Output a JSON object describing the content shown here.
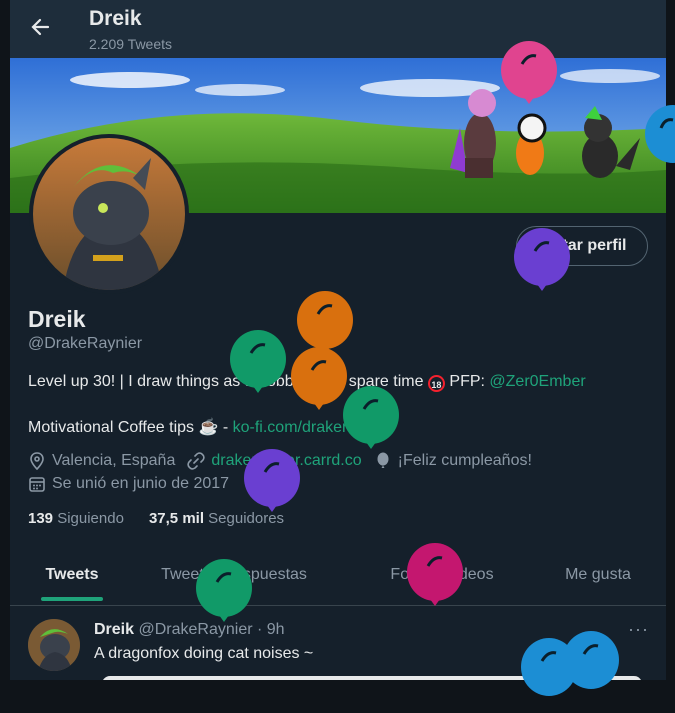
{
  "header": {
    "name": "Dreik",
    "tweet_count": "2.209 Tweets"
  },
  "profile": {
    "edit_button": "Editar perfil",
    "name": "Dreik",
    "handle": "@DrakeRaynier",
    "bio_line1_text": "Level up 30! | I draw things as a hobby in my spare time",
    "bio_badge": "18",
    "bio_line1_pfp": "PFP:",
    "bio_line1_link": "@Zer0Ember",
    "bio_line2_text": "Motivational Coffee tips",
    "bio_line2_emoji": "☕",
    "bio_line2_dash": "-",
    "bio_line2_link": "ko-fi.com/drakeraynier",
    "location": "Valencia, España",
    "website": "drakeraynier.carrd.co",
    "birthday": "¡Feliz cumpleaños!",
    "joined": "Se unió en junio de 2017",
    "following_count": "139",
    "following_label": "Siguiendo",
    "followers_count": "37,5 mil",
    "followers_label": "Seguidores"
  },
  "tabs": [
    {
      "label": "Tweets",
      "active": true
    },
    {
      "label": "Tweets y respuestas",
      "active": false
    },
    {
      "label": "Fotos y videos",
      "active": false
    },
    {
      "label": "Me gusta",
      "active": false
    }
  ],
  "tweet": {
    "name": "Dreik",
    "handle": "@DrakeRaynier",
    "time": "· 9h",
    "text": "A dragonfox doing cat noises ~",
    "more": "···"
  },
  "colors": {
    "background": "#15202b",
    "accent": "#1fa37a",
    "secondary_text": "#8b98a5",
    "balloon_pink": "#e0448f",
    "balloon_purple": "#6a3fd1",
    "balloon_orange": "#d9700e",
    "balloon_green": "#119a68",
    "balloon_magenta": "#c4176f",
    "balloon_blue": "#1c8ed4"
  }
}
